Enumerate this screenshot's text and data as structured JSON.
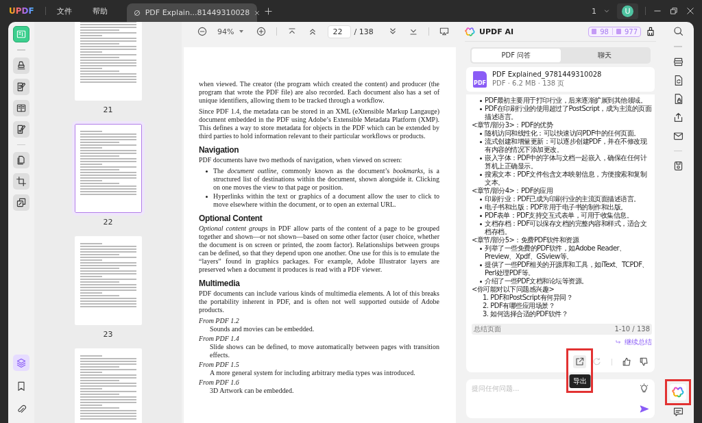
{
  "title_bar": {
    "logo": "UPDF",
    "menus": [
      {
        "label": "文件"
      },
      {
        "label": "帮助"
      }
    ],
    "tabs": [
      {
        "title": "PDF Explain...81449310028",
        "selected": true
      }
    ],
    "workspace_switcher": "1",
    "avatar": "U"
  },
  "left_toolbar": {
    "tools": [
      {
        "kind": "reader",
        "selected": true
      },
      {
        "kind": "divider"
      },
      {
        "kind": "comment",
        "selected": false
      },
      {
        "kind": "edit",
        "selected": false
      },
      {
        "kind": "form",
        "selected": false
      },
      {
        "kind": "sign",
        "selected": false
      },
      {
        "kind": "divider"
      },
      {
        "kind": "organize",
        "selected": false
      },
      {
        "kind": "crop",
        "selected": false
      },
      {
        "kind": "compress",
        "selected": false
      }
    ],
    "panels": [
      {
        "kind": "layers",
        "selected": true
      },
      {
        "kind": "bookmark",
        "selected": false
      },
      {
        "kind": "attachment",
        "selected": false
      }
    ]
  },
  "thumbnails": [
    {
      "label": "21",
      "selected": false
    },
    {
      "label": "22",
      "selected": true
    },
    {
      "label": "23",
      "selected": false
    },
    {
      "selected": false
    }
  ],
  "doc_toolbar": {
    "zoom": "94%",
    "page": "22",
    "total": "/ 138"
  },
  "document": {
    "blocks": [
      {
        "kind": "paragraph",
        "text": "when viewed. The creator (the program which created the content) and producer (the program that wrote the PDF file) are also recorded. Each document also has a set of unique identifiers, allowing them to be tracked through a workflow."
      },
      {
        "kind": "paragraph",
        "text": "Since PDF 1.4, the metadata can be stored in an XML (eXtensible Markup Langauge) document embedded in the PDF using Adobe’s Extensible Metadata Platform (XMP). This defines a way to store metadata for objects in the PDF which can be extended by third parties to hold information relevant to their particular workflows or products."
      },
      {
        "kind": "heading",
        "text": "Navigation"
      },
      {
        "kind": "paragraph",
        "text": "PDF documents have two methods of navigation, when viewed on screen:"
      },
      {
        "kind": "bullets",
        "items": [
          "The *document outline*, commonly known as the document’s *bookmarks*, is a structured list of destinations within the document, shown alongside it. Clicking on one moves the view to that page or position.",
          "Hyperlinks within the text or graphics of a document allow the user to click to move elsewhere within the document, or to open an external URL."
        ]
      },
      {
        "kind": "heading",
        "text": "Optional Content"
      },
      {
        "kind": "paragraph",
        "text": "*Optional content groups* in PDF allow parts of the content of a page to be grouped together and shown—or not shown—based on some other factor (user choice, whether the document is on screen or printed, the zoom factor). Relationships between groups can be defined, so that they depend upon one another. One use for this is to emulate the “layers” found in graphics packages. For example, Adobe Illustrator layers are preserved when a document it produces is read with a PDF viewer."
      },
      {
        "kind": "heading",
        "text": "Multimedia"
      },
      {
        "kind": "paragraph",
        "text": "PDF documents can include various kinds of multimedia elements. A lot of this breaks the portability inherent in PDF, and is often not well supported outside of Adobe products."
      },
      {
        "kind": "definition",
        "term": "From PDF 1.2",
        "text": "Sounds and movies can be embedded."
      },
      {
        "kind": "definition",
        "term": "From PDF 1.4",
        "text": "Slide shows can be defined, to move automatically between pages with transition effects."
      },
      {
        "kind": "definition",
        "term": "From PDF 1.5",
        "text": "A more general system for including arbitrary media types was introduced."
      },
      {
        "kind": "definition",
        "term": "From PDF 1.6",
        "text": "3D Artwork can be embedded."
      }
    ]
  },
  "ai_panel": {
    "title": "UPDF AI",
    "credits": [
      "98",
      "977"
    ],
    "tabs": [
      {
        "label": "PDF 问答",
        "selected": true
      },
      {
        "label": "聊天",
        "selected": false
      }
    ],
    "file": {
      "icon_label": "PDF",
      "name": "PDF Explained_9781449310028",
      "meta": "PDF · 6.2 MB · 138 页"
    },
    "answer": [
      {
        "kind": "bullet",
        "text": "PDF最初主要用于打印行业，后来逐渐扩展到其他领域。"
      },
      {
        "kind": "bullet",
        "text": "PDF在印刷行业的使用超过了PostScript，成为主流的页面描述语言。"
      },
      {
        "kind": "heading",
        "text": "<章节/部分3>：PDF的优势"
      },
      {
        "kind": "bullet",
        "text": "随机访问和线性化：可以快速访问PDF中的任何页面。"
      },
      {
        "kind": "bullet",
        "text": "流式创建和增量更新：可以逐步创建PDF，并在不修改现有内容的情况下添加更改。"
      },
      {
        "kind": "bullet",
        "text": "嵌入字体：PDF中的字体与文档一起嵌入，确保在任何计算机上正确显示。"
      },
      {
        "kind": "bullet",
        "text": "搜索文本：PDF文件包含文本映射信息，方便搜索和复制文本。"
      },
      {
        "kind": "heading",
        "text": "<章节/部分4>：PDF的应用"
      },
      {
        "kind": "bullet",
        "text": "印刷行业：PDF已成为印刷行业的主流页面描述语言。"
      },
      {
        "kind": "bullet",
        "text": "电子书和出版：PDF常用于电子书的制作和出版。"
      },
      {
        "kind": "bullet",
        "text": "PDF表单：PDF支持交互式表单，可用于收集信息。"
      },
      {
        "kind": "bullet",
        "text": "文档存档：PDF可以保存文档的完整内容和样式，适合文档存档。"
      },
      {
        "kind": "heading",
        "text": "<章节/部分5>：免费PDF软件和资源"
      },
      {
        "kind": "bullet",
        "text": "列举了一些免费的PDF软件，如Adobe Reader、Preview、Xpdf、GSview等。"
      },
      {
        "kind": "bullet",
        "text": "提供了一些PDF相关的开源库和工具，如iText、TCPDF、Perl处理PDF等。"
      },
      {
        "kind": "bullet",
        "text": "介绍了一些PDF文档和论坛等资源。"
      },
      {
        "kind": "heading",
        "text": "<你可能对以下问题感兴趣>"
      },
      {
        "kind": "numbered",
        "text": "1. PDF和PostScript有何异同？"
      },
      {
        "kind": "numbered",
        "text": "2. PDF有哪些应用场景？"
      },
      {
        "kind": "numbered",
        "text": "3. 如何选择合适的PDF软件？"
      }
    ],
    "summary": {
      "label": "总结页面",
      "range": "1-10 / 138"
    },
    "continue": "继续总结",
    "actions": [
      {
        "kind": "export",
        "disabled": false,
        "highlighted": true,
        "tooltip": "导出"
      },
      {
        "kind": "regenerate",
        "disabled": true,
        "highlighted": false
      },
      {
        "kind": "like",
        "disabled": false,
        "highlighted": false
      },
      {
        "kind": "dislike",
        "disabled": false,
        "highlighted": false
      }
    ],
    "input": {
      "placeholder": "提问任何问题..."
    }
  },
  "right_toolbar": {
    "tools": [
      {
        "kind": "search"
      },
      {
        "kind": "divider"
      },
      {
        "kind": "ocr"
      },
      {
        "kind": "convert"
      },
      {
        "kind": "protect"
      },
      {
        "kind": "share"
      },
      {
        "kind": "mail"
      },
      {
        "kind": "divider"
      },
      {
        "kind": "save"
      }
    ],
    "bottom": [
      {
        "kind": "ai",
        "highlighted": true
      },
      {
        "kind": "comment",
        "highlighted": false
      }
    ]
  }
}
